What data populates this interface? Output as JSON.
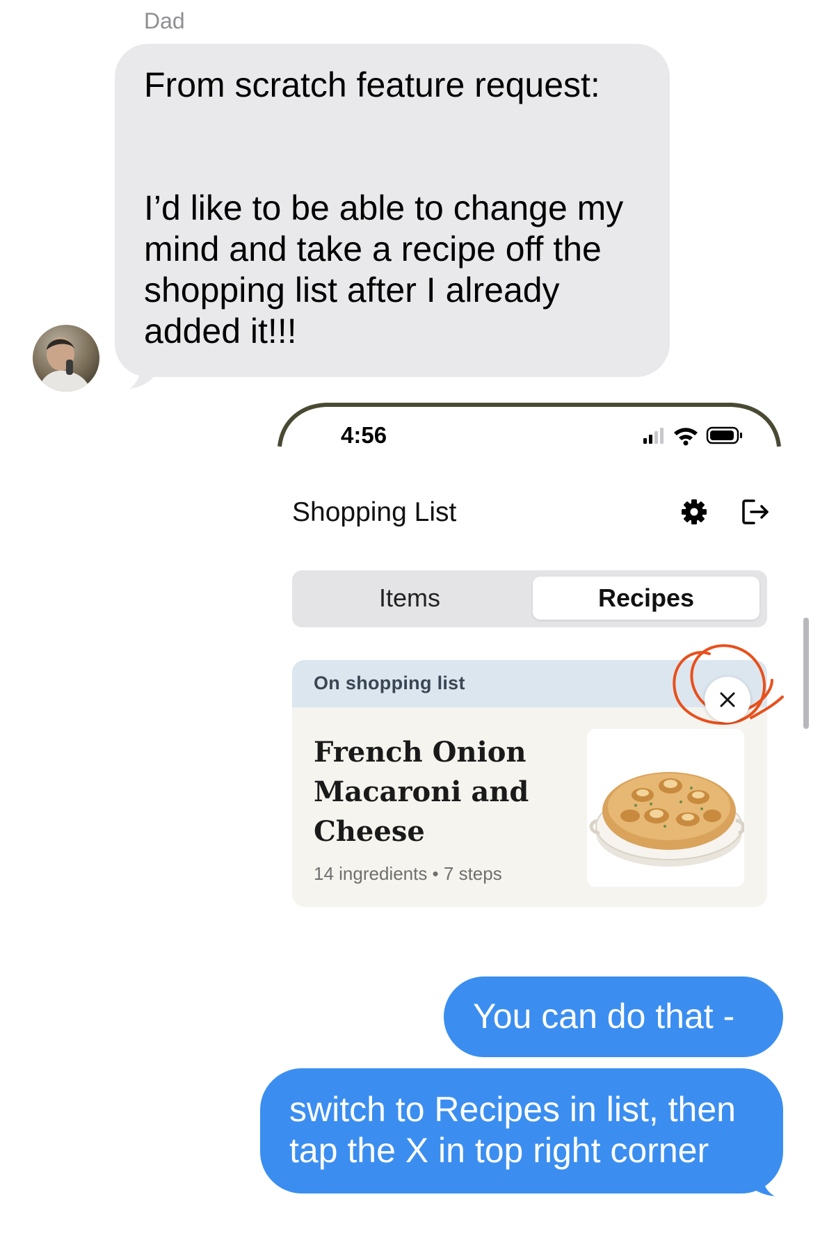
{
  "conversation": {
    "sender_name": "Dad",
    "incoming_message": {
      "lines_top": [
        "From scratch feature request:"
      ],
      "lines_bottom": [
        "I’d like to be able to change my",
        "mind and take a recipe off the",
        "shopping list after I already",
        "added it!!!"
      ]
    },
    "outgoing_messages": [
      {
        "lines": [
          "You can do that -"
        ]
      },
      {
        "lines": [
          "switch to Recipes in list, then",
          "tap the X in top right corner"
        ]
      }
    ],
    "bubble_colors": {
      "incoming": "#e9e9eb",
      "outgoing": "#3b8ef0"
    }
  },
  "attachment": {
    "status_bar": {
      "time": "4:56",
      "icons": [
        "signal-icon",
        "wifi-icon",
        "battery-icon"
      ]
    },
    "app": {
      "title": "Shopping List",
      "header_icons": [
        "gear-icon",
        "logout-icon"
      ],
      "tabs": [
        {
          "label": "Items",
          "selected": false
        },
        {
          "label": "Recipes",
          "selected": true
        }
      ],
      "card": {
        "header_label": "On shopping list",
        "title_lines": [
          "French Onion",
          "Macaroni and",
          "Cheese"
        ],
        "meta": "14 ingredients • 7 steps",
        "image": "baked-mac-and-cheese-dish",
        "remove_icon": "close-icon"
      }
    },
    "annotation": {
      "color": "#e8501c",
      "icon": "hand-drawn-circle"
    }
  }
}
